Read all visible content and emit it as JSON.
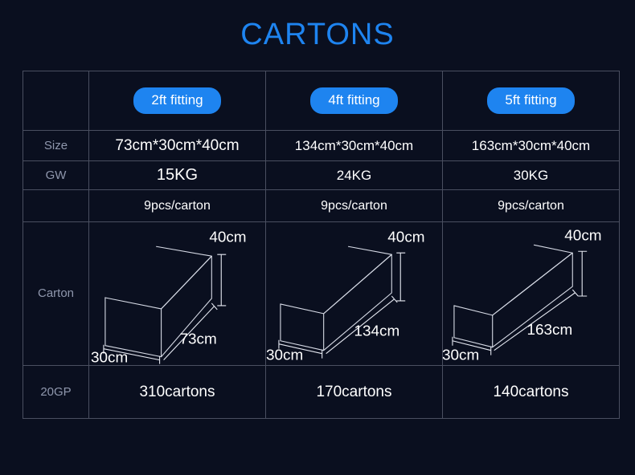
{
  "page": {
    "title": "CARTONS",
    "title_color": "#1e84f0",
    "background_color": "#0a0f1f",
    "border_color": "#4a4f60",
    "label_color": "#8f97ad"
  },
  "table": {
    "corner_label": "",
    "columns": [
      {
        "pill_label": "2ft fitting"
      },
      {
        "pill_label": "4ft fitting"
      },
      {
        "pill_label": "5ft fitting"
      }
    ],
    "rows": {
      "size": {
        "label": "Size",
        "values": [
          "73cm*30cm*40cm",
          "134cm*30cm*40cm",
          "163cm*30cm*40cm"
        ]
      },
      "gw": {
        "label": "GW",
        "values": [
          "15KG",
          "24KG",
          "30KG"
        ]
      },
      "pcs": {
        "label": "",
        "values": [
          "9pcs/carton",
          "9pcs/carton",
          "9pcs/carton"
        ]
      },
      "carton": {
        "label": "Carton",
        "diagrams": [
          {
            "length_label": "73cm",
            "width_label": "30cm",
            "height_label": "40cm"
          },
          {
            "length_label": "134cm",
            "width_label": "30cm",
            "height_label": "40cm"
          },
          {
            "length_label": "163cm",
            "width_label": "30cm",
            "height_label": "40cm"
          }
        ]
      },
      "gp": {
        "label": "20GP",
        "values": [
          "310cartons",
          "170cartons",
          "140cartons"
        ]
      }
    }
  }
}
